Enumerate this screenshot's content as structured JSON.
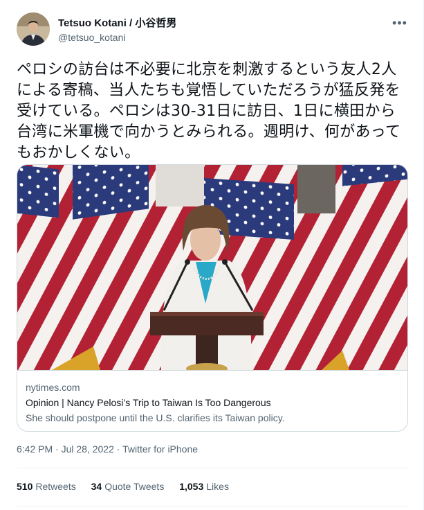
{
  "author": {
    "display_name": "Tetsuo Kotani / 小谷哲男",
    "handle": "@tetsuo_kotani"
  },
  "tweet": {
    "text": "ペロシの訪台は不必要に北京を刺激するという友人2人による寄稿、当人たちも覚悟していただろうが猛反発を受けている。ペロシは30-31日に訪日、1日に横田から台湾に米軍機で向かうとみられる。週明け、何があってもおかしくない。"
  },
  "card": {
    "domain": "nytimes.com",
    "title": "Opinion | Nancy Pelosi’s Trip to Taiwan Is Too Dangerous",
    "description": "She should postpone until the U.S. clarifies its Taiwan policy."
  },
  "meta": {
    "time": "6:42 PM",
    "separator1": " · ",
    "date": "Jul 28, 2022",
    "separator2": " · ",
    "source": "Twitter for iPhone"
  },
  "stats": {
    "retweets_count": "510",
    "retweets_label": "Retweets",
    "quotes_count": "34",
    "quotes_label": "Quote Tweets",
    "likes_count": "1,053",
    "likes_label": "Likes"
  },
  "icons": {
    "more": "more-options-icon"
  },
  "colors": {
    "text_primary": "#0f1419",
    "text_secondary": "#536471",
    "border": "#cfd9de",
    "flag_red": "#b22234",
    "flag_blue": "#2b3a7a",
    "blazer": "#f2f0ec",
    "shirt": "#29a8c8"
  }
}
